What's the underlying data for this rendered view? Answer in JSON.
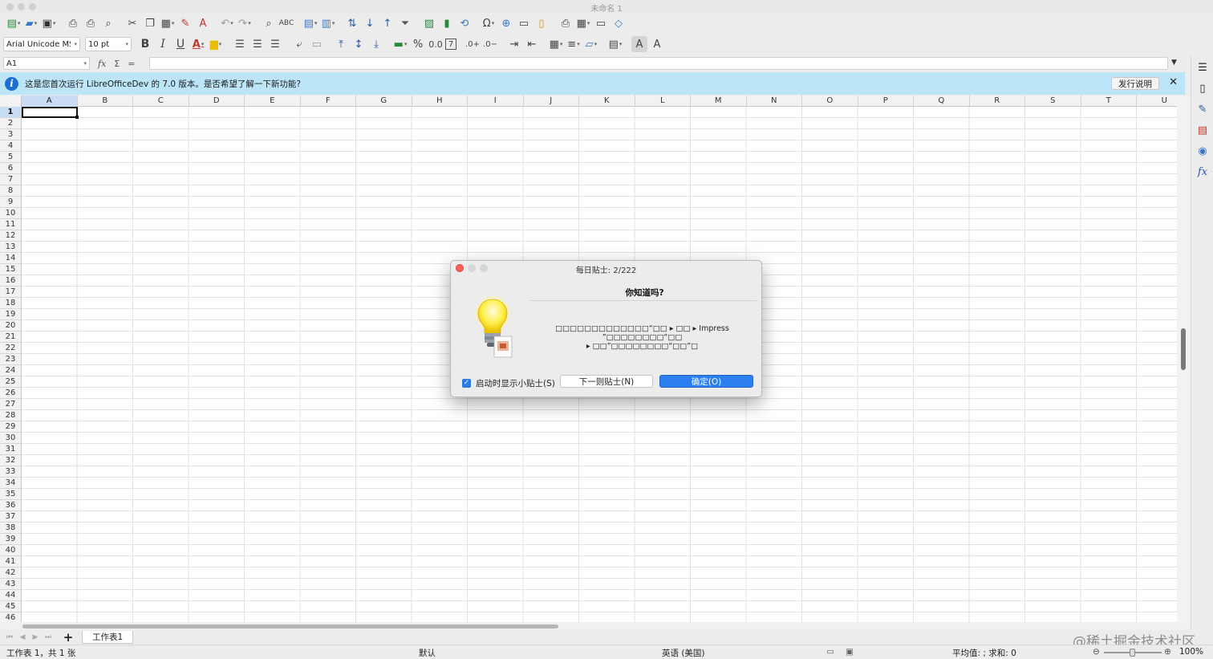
{
  "window": {
    "title": "未命名 1"
  },
  "toolbar_standard": {
    "icons": [
      "new-document-icon",
      "open-icon",
      "save-icon",
      "export-pdf-icon",
      "print-icon",
      "print-preview-icon",
      "cut-icon",
      "copy-icon",
      "paste-icon",
      "clone-formatting-icon",
      "clear-formatting-icon",
      "undo-icon",
      "redo-icon",
      "find-replace-icon",
      "spelling-icon",
      "row-icon",
      "column-icon",
      "sort-icon",
      "sort-ascending-icon",
      "sort-descending-icon",
      "autofilter-icon",
      "insert-image-icon",
      "insert-chart-icon",
      "pivot-table-icon",
      "special-character-icon",
      "hyperlink-icon",
      "comment-icon",
      "header-footer-icon",
      "define-print-area-icon",
      "freeze-icon",
      "split-window-icon",
      "show-draw-functions-icon"
    ]
  },
  "toolbar_format": {
    "font_name": "Arial Unicode MS",
    "font_size": "10 pt",
    "bold": "B",
    "italic": "I",
    "underline": "U",
    "font_color_glyph": "A",
    "percent": "%",
    "number_format": "0.0",
    "date_glyph": "7"
  },
  "formula_bar": {
    "name_box": "A1",
    "fx": "fx",
    "sigma": "Σ",
    "equals": "="
  },
  "infobar": {
    "message": "这是您首次运行 LibreOfficeDev 的 7.0 版本。是否希望了解一下新功能?",
    "release_notes": "发行说明",
    "close": "✕"
  },
  "columns": [
    "A",
    "B",
    "C",
    "D",
    "E",
    "F",
    "G",
    "H",
    "I",
    "J",
    "K",
    "L",
    "M",
    "N",
    "O",
    "P",
    "Q",
    "R",
    "S",
    "T",
    "U"
  ],
  "rows": [
    "1",
    "2",
    "3",
    "4",
    "5",
    "6",
    "7",
    "8",
    "9",
    "10",
    "11",
    "12",
    "13",
    "14",
    "15",
    "16",
    "17",
    "18",
    "19",
    "20",
    "21",
    "22",
    "23",
    "24",
    "25",
    "26",
    "27",
    "28",
    "29",
    "30",
    "31",
    "32",
    "33",
    "34",
    "35",
    "36",
    "37",
    "38",
    "39",
    "40",
    "41",
    "42",
    "43",
    "44",
    "45",
    "46"
  ],
  "selected_cell": "A1",
  "sheet_tabs": {
    "add": "+",
    "tabs": [
      "工作表1"
    ],
    "watermark": "@稀土掘金技术社区"
  },
  "status_bar": {
    "sheet_info": "工作表 1，共 1 张",
    "page_style": "默认",
    "language": "英语 (美国)",
    "summary": "平均值: ; 求和: 0",
    "zoom": "100%"
  },
  "dialog": {
    "title": "每日贴士: 2/222",
    "heading": "你知道吗?",
    "tip_line1": "□□□□□□□□□□□□□“□□ ▸ □□ ▸ Impress ”□□□□□□□□“□□",
    "tip_line2": "▸ □□”□□□□□□□□“□□”□",
    "checkbox_label": "启动时显示小贴士(S)",
    "checkbox_checked": true,
    "next_button": "下一则贴士(N)",
    "ok_button": "确定(O)"
  },
  "colors": {
    "infobar_bg": "#bde5f8",
    "accent_blue": "#2d7ff0",
    "selection_header": "#c8dcf3"
  }
}
